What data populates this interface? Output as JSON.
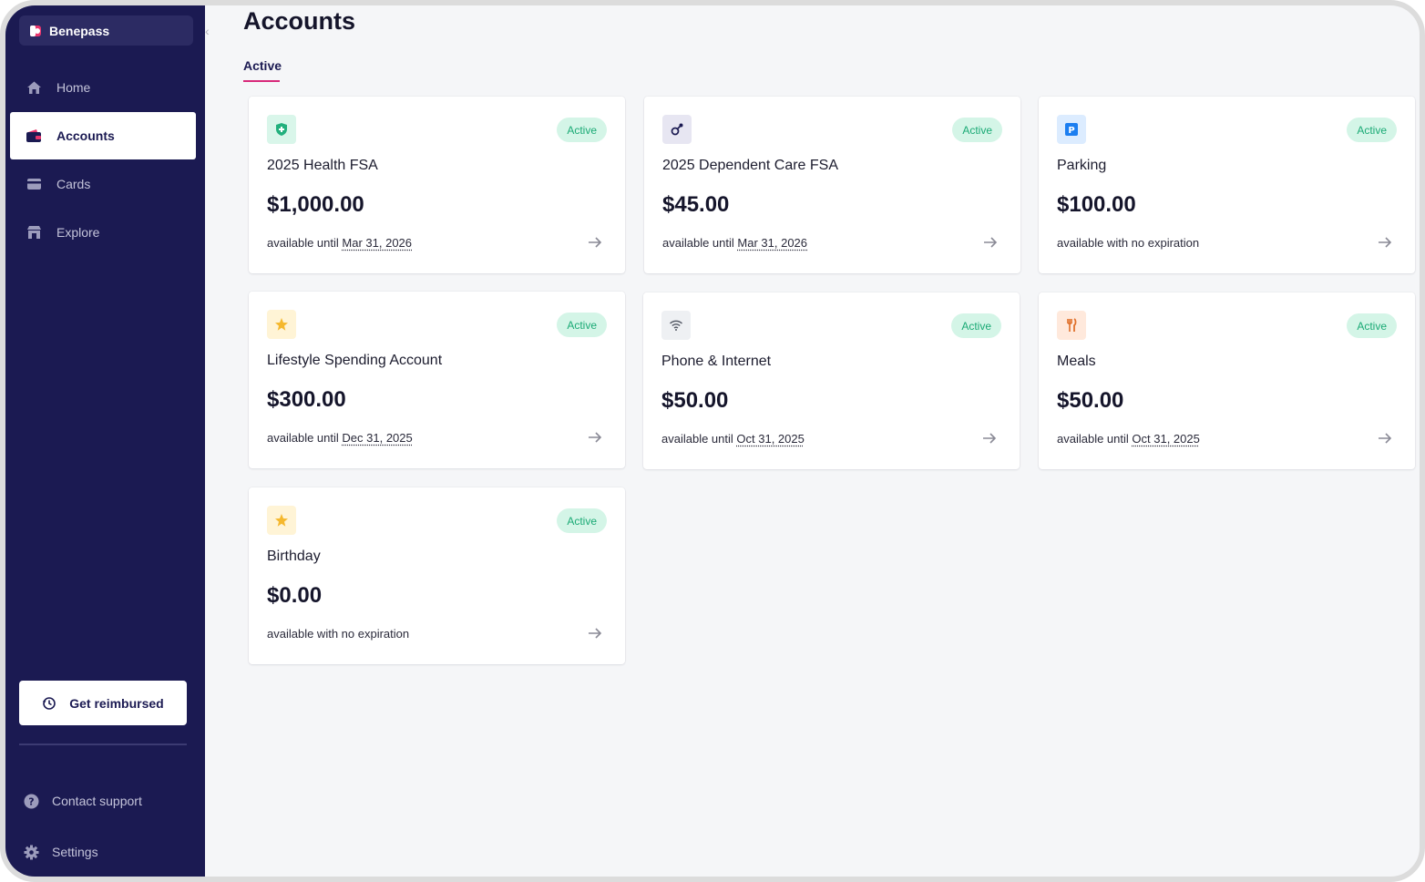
{
  "sidebar": {
    "brand": "Benepass",
    "nav": [
      {
        "label": "Home",
        "icon": "home-icon",
        "active": false
      },
      {
        "label": "Accounts",
        "icon": "wallet-icon",
        "active": true
      },
      {
        "label": "Cards",
        "icon": "card-icon",
        "active": false
      },
      {
        "label": "Explore",
        "icon": "store-icon",
        "active": false
      }
    ],
    "reimburse_label": "Get reimbursed",
    "contact_label": "Contact support",
    "settings_label": "Settings"
  },
  "main": {
    "title": "Accounts",
    "tab_active": "Active"
  },
  "accounts": [
    {
      "name": "2025 Health FSA",
      "amount": "$1,000.00",
      "prefix": "available until",
      "date": "Mar 31, 2026",
      "status": "Active",
      "icon": "shield-plus-icon"
    },
    {
      "name": "2025 Dependent Care FSA",
      "amount": "$45.00",
      "prefix": "available until",
      "date": "Mar 31, 2026",
      "status": "Active",
      "icon": "pacifier-icon"
    },
    {
      "name": "Parking",
      "amount": "$100.00",
      "prefix": "available with no expiration",
      "date": "",
      "status": "Active",
      "icon": "parking-icon"
    },
    {
      "name": "Lifestyle Spending Account",
      "amount": "$300.00",
      "prefix": "available until",
      "date": "Dec 31, 2025",
      "status": "Active",
      "icon": "star-icon"
    },
    {
      "name": "Phone & Internet",
      "amount": "$50.00",
      "prefix": "available until",
      "date": "Oct 31, 2025",
      "status": "Active",
      "icon": "wifi-icon"
    },
    {
      "name": "Meals",
      "amount": "$50.00",
      "prefix": "available until",
      "date": "Oct 31, 2025",
      "status": "Active",
      "icon": "utensils-icon"
    },
    {
      "name": "Birthday",
      "amount": "$0.00",
      "prefix": "available with no expiration",
      "date": "",
      "status": "Active",
      "icon": "star-icon"
    }
  ],
  "colors": {
    "sidebar_bg": "#1b1a52",
    "accent": "#d8297a",
    "badge_bg": "#d4f5e7",
    "badge_text": "#1aaa75"
  }
}
